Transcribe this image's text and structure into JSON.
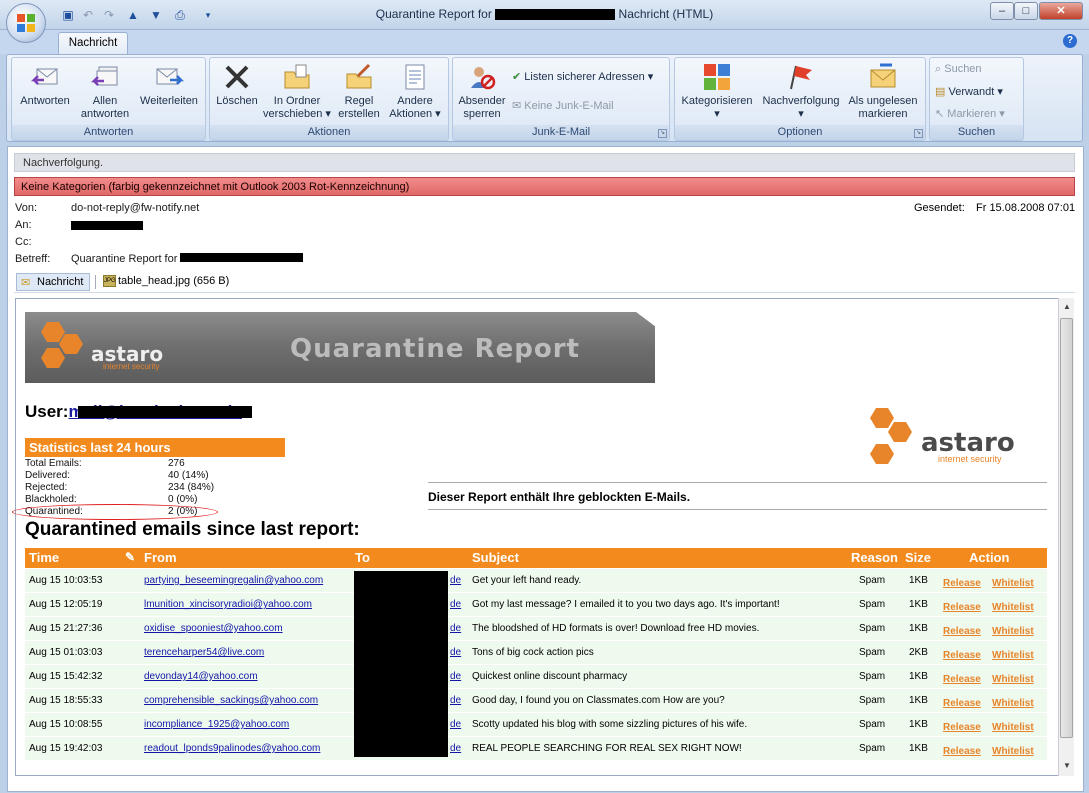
{
  "window": {
    "title_prefix": "Quarantine Report for",
    "title_suffix": "Nachricht (HTML)",
    "min": "–",
    "max": "□",
    "close": "✕"
  },
  "tabs": [
    "Nachricht"
  ],
  "ribbon": {
    "antworten": {
      "label": "Antworten",
      "buttons": [
        "Antworten",
        "Allen antworten",
        "Weiterleiten"
      ]
    },
    "aktionen": {
      "label": "Aktionen",
      "buttons": [
        "Löschen",
        "In Ordner verschieben",
        "Regel erstellen",
        "Andere Aktionen"
      ]
    },
    "junk": {
      "label": "Junk-E-Mail",
      "sender": "Absender sperren",
      "safe": "Listen sicherer Adressen",
      "nojunk": "Keine Junk-E-Mail"
    },
    "optionen": {
      "label": "Optionen",
      "buttons": [
        "Kategorisieren",
        "Nachverfolgung",
        "Als ungelesen markieren"
      ]
    },
    "suchen": {
      "label": "Suchen",
      "find": "Suchen",
      "related": "Verwandt",
      "mark": "Markieren"
    }
  },
  "header": {
    "infobar": "Nachverfolgung.",
    "category": "Keine Kategorien (farbig gekennzeichnet mit Outlook 2003 Rot-Kennzeichnung)",
    "from_label": "Von:",
    "from": "do-not-reply@fw-notify.net",
    "to_label": "An:",
    "cc_label": "Cc:",
    "subject_label": "Betreff:",
    "subject": "Quarantine Report for",
    "sent_label": "Gesendet:",
    "sent": "Fr 15.08.2008 07:01"
  },
  "attachments": {
    "message": "Nachricht",
    "file": "table_head.jpg (656 B)"
  },
  "report": {
    "banner_title": "Quarantine Report",
    "brand": "astaro",
    "brand_sub": "internet security",
    "user_label": "User:",
    "user_mail": "mail@bastianhaas.de",
    "stats_title": "Statistics last 24 hours",
    "stats": [
      {
        "label": "Total Emails:",
        "value": "276"
      },
      {
        "label": "Delivered:",
        "value": "40 (14%)"
      },
      {
        "label": "Rejected:",
        "value": "234 (84%)"
      },
      {
        "label": "Blackholed:",
        "value": "0 (0%)"
      },
      {
        "label": "Quarantined:",
        "value": "2 (0%)"
      }
    ],
    "notice": "Dieser Report enthält Ihre geblockten E-Mails.",
    "section_title": "Quarantined emails since last report:",
    "columns": [
      "Time",
      "From",
      "To",
      "Subject",
      "Reason",
      "Size",
      "Action"
    ],
    "rows": [
      {
        "time": "Aug 15 10:03:53",
        "from": "partying_beseemingregalin@yahoo.com",
        "to": "de",
        "subject": "Get your left hand ready.",
        "reason": "Spam",
        "size": "1KB"
      },
      {
        "time": "Aug 15 12:05:19",
        "from": "lmunition_xincisoryradioi@yahoo.com",
        "to": "de",
        "subject": "Got my last message? I emailed it to you two days ago. It's important!",
        "reason": "Spam",
        "size": "1KB"
      },
      {
        "time": "Aug 15 21:27:36",
        "from": "oxidise_spooniest@yahoo.com",
        "to": "de",
        "subject": "The bloodshed of HD formats is over! Download free HD movies.",
        "reason": "Spam",
        "size": "1KB"
      },
      {
        "time": "Aug 15 01:03:03",
        "from": "terenceharper54@live.com",
        "to": "de",
        "subject": "Tons of big cock action pics",
        "reason": "Spam",
        "size": "2KB"
      },
      {
        "time": "Aug 15 15:42:32",
        "from": "devonday14@yahoo.com",
        "to": "de",
        "subject": "Quickest online discount pharmacy",
        "reason": "Spam",
        "size": "1KB"
      },
      {
        "time": "Aug 15 18:55:33",
        "from": "comprehensible_sackings@yahoo.com",
        "to": "de",
        "subject": "Good day, I found you on Classmates.com How are you?",
        "reason": "Spam",
        "size": "1KB"
      },
      {
        "time": "Aug 15 10:08:55",
        "from": "incompliance_1925@yahoo.com",
        "to": "de",
        "subject": "Scotty updated his blog with some sizzling pictures of his wife.",
        "reason": "Spam",
        "size": "1KB"
      },
      {
        "time": "Aug 15 19:42:03",
        "from": "readout_lponds9palinodes@yahoo.com",
        "to": "de",
        "subject": "REAL PEOPLE SEARCHING FOR REAL SEX RIGHT NOW!",
        "reason": "Spam",
        "size": "1KB"
      }
    ],
    "release": "Release",
    "whitelist": "Whitelist"
  }
}
